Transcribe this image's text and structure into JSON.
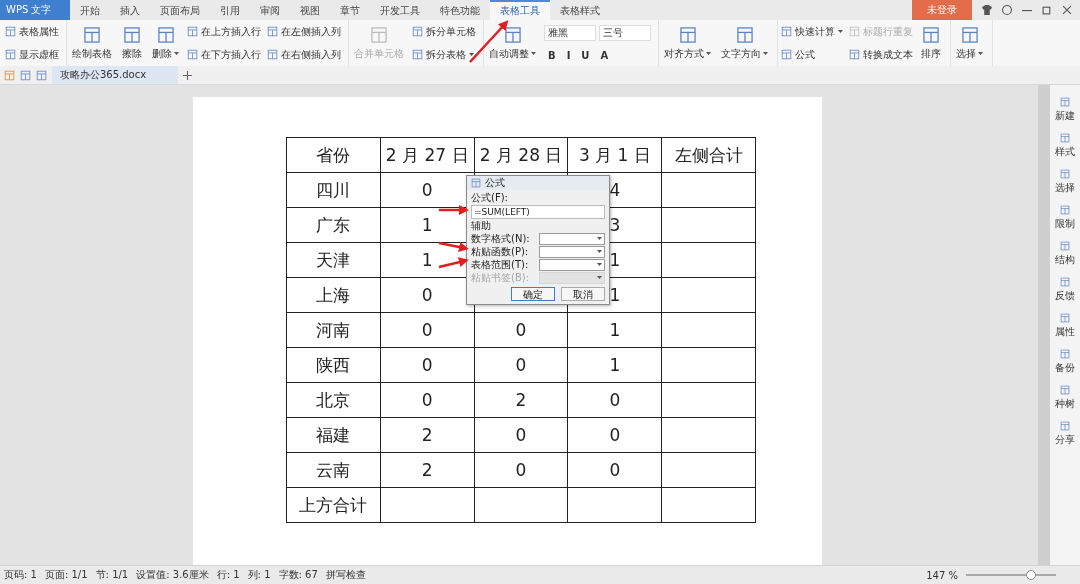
{
  "app_menu": {
    "label": "WPS 文字"
  },
  "tabs": [
    {
      "label": "开始",
      "selected": false
    },
    {
      "label": "插入",
      "selected": false
    },
    {
      "label": "页面布局",
      "selected": false
    },
    {
      "label": "引用",
      "selected": false
    },
    {
      "label": "审阅",
      "selected": false
    },
    {
      "label": "视图",
      "selected": false
    },
    {
      "label": "章节",
      "selected": false
    },
    {
      "label": "开发工具",
      "selected": false
    },
    {
      "label": "特色功能",
      "selected": false
    },
    {
      "label": "表格工具",
      "selected": true
    },
    {
      "label": "表格样式",
      "selected": false
    }
  ],
  "login": {
    "label": "未登录"
  },
  "ribbon": [
    {
      "columns": [
        [
          {
            "kind": "small",
            "label": "表格属性",
            "disabled": false,
            "dropdown": false
          },
          {
            "kind": "small",
            "label": "显示虚框",
            "disabled": false,
            "dropdown": false
          }
        ]
      ]
    },
    {
      "columns": [
        [
          {
            "kind": "big",
            "label": "绘制表格",
            "disabled": false,
            "dropdown": false
          }
        ],
        [
          {
            "kind": "big",
            "label": "擦除",
            "disabled": false,
            "dropdown": false
          }
        ],
        [
          {
            "kind": "big",
            "label": "删除",
            "disabled": false,
            "dropdown": true
          }
        ],
        [
          {
            "kind": "small",
            "label": "在上方插入行",
            "disabled": false,
            "dropdown": false
          },
          {
            "kind": "small",
            "label": "在下方插入行",
            "disabled": false,
            "dropdown": false
          }
        ],
        [
          {
            "kind": "small",
            "label": "在左侧插入列",
            "disabled": false,
            "dropdown": false
          },
          {
            "kind": "small",
            "label": "在右侧插入列",
            "disabled": false,
            "dropdown": false
          }
        ]
      ]
    },
    {
      "columns": [
        [
          {
            "kind": "big",
            "label": "合并单元格",
            "disabled": true,
            "dropdown": false
          }
        ],
        [
          {
            "kind": "small",
            "label": "拆分单元格",
            "disabled": false,
            "dropdown": false
          },
          {
            "kind": "small",
            "label": "拆分表格",
            "disabled": false,
            "dropdown": true
          }
        ]
      ]
    },
    {
      "columns": [
        [
          {
            "kind": "big",
            "label": "自动调整",
            "disabled": false,
            "dropdown": true
          }
        ],
        [
          {
            "kind": "selects",
            "values": [
              "雅黑",
              "三号"
            ]
          },
          {
            "kind": "glyphs",
            "values": [
              "B",
              "I",
              "U",
              "A"
            ]
          }
        ]
      ]
    },
    {
      "columns": [
        [
          {
            "kind": "big",
            "label": "对齐方式",
            "disabled": false,
            "dropdown": true
          }
        ],
        [
          {
            "kind": "big",
            "label": "文字方向",
            "disabled": false,
            "dropdown": true
          }
        ]
      ]
    },
    {
      "columns": [
        [
          {
            "kind": "small",
            "label": "快速计算",
            "disabled": false,
            "dropdown": true
          },
          {
            "kind": "small",
            "label": "公式",
            "disabled": false,
            "dropdown": false
          }
        ],
        [
          {
            "kind": "small",
            "label": "标题行重复",
            "disabled": true,
            "dropdown": false
          },
          {
            "kind": "small",
            "label": "转换成文本",
            "disabled": false,
            "dropdown": false
          }
        ],
        [
          {
            "kind": "big",
            "label": "排序",
            "disabled": false,
            "dropdown": false
          }
        ]
      ]
    },
    {
      "columns": [
        [
          {
            "kind": "big",
            "label": "选择",
            "disabled": false,
            "dropdown": true
          }
        ]
      ]
    }
  ],
  "document_tab": {
    "label": "攻略办公365.docx"
  },
  "table": {
    "rows": [
      [
        "省份",
        "2 月 27 日",
        "2 月 28 日",
        "3 月 1 日",
        "左侧合计"
      ],
      [
        "四川",
        "0",
        null,
        "4",
        null
      ],
      [
        "广东",
        "1",
        null,
        "3",
        null
      ],
      [
        "天津",
        "1",
        null,
        "1",
        null
      ],
      [
        "上海",
        "0",
        null,
        "1",
        null
      ],
      [
        "河南",
        "0",
        "0",
        "1",
        null
      ],
      [
        "陕西",
        "0",
        "0",
        "1",
        null
      ],
      [
        "北京",
        "0",
        "2",
        "0",
        null
      ],
      [
        "福建",
        "2",
        "0",
        "0",
        null
      ],
      [
        "云南",
        "2",
        "0",
        "0",
        null
      ],
      [
        "上方合计",
        null,
        null,
        null,
        null
      ]
    ]
  },
  "dialog": {
    "title": "公式",
    "formula_label": "公式(F):",
    "formula_value": "=SUM(LEFT)",
    "group_label": "辅助",
    "fields": [
      {
        "label": "数字格式(N):",
        "disabled": false
      },
      {
        "label": "粘贴函数(P):",
        "disabled": false
      },
      {
        "label": "表格范围(T):",
        "disabled": false
      },
      {
        "label": "粘贴书签(B):",
        "disabled": true
      }
    ],
    "buttons": [
      {
        "label": "确定",
        "selected": true
      },
      {
        "label": "取消",
        "selected": false
      }
    ]
  },
  "sidebar": [
    "新建",
    "样式",
    "选择",
    "限制",
    "结构",
    "反馈",
    "属性",
    "备份",
    "种树",
    "分享"
  ],
  "status_bar": {
    "items": [
      "页码: 1",
      "页面: 1/1",
      "节: 1/1",
      "设置值: 3.6厘米",
      "行: 1",
      "列: 1",
      "字数: 67",
      "拼写检查"
    ],
    "zoom": "147 %",
    "zoom_slider": {
      "level": 0.72
    }
  }
}
